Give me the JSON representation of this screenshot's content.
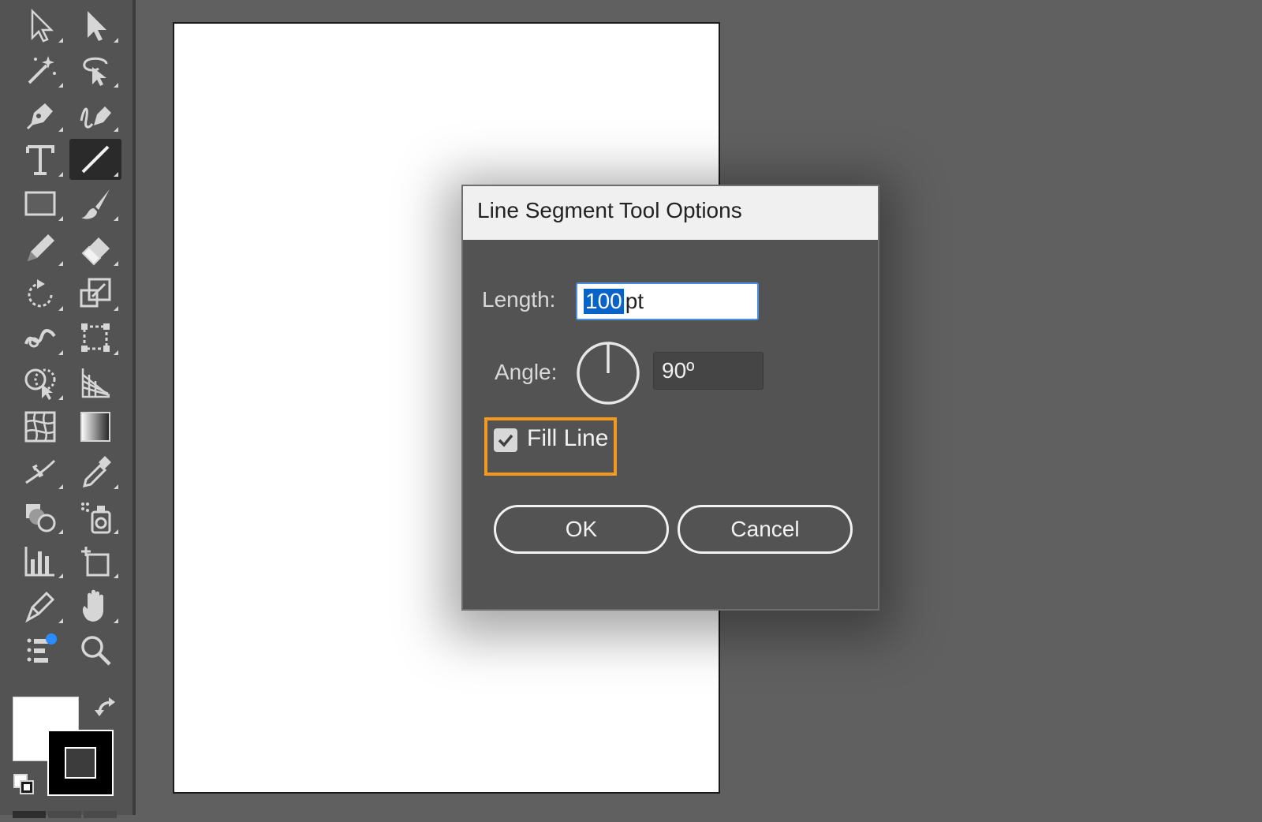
{
  "toolbar": {
    "tools": [
      {
        "name": "selection-tool",
        "icon": "selection-arrow-icon",
        "active": false
      },
      {
        "name": "direct-selection-tool",
        "icon": "direct-selection-arrow-icon",
        "active": false
      },
      {
        "name": "magic-wand-tool",
        "icon": "magic-wand-icon",
        "active": false
      },
      {
        "name": "lasso-tool",
        "icon": "lasso-icon",
        "active": false
      },
      {
        "name": "pen-tool",
        "icon": "pen-icon",
        "active": false
      },
      {
        "name": "curvature-tool",
        "icon": "curvature-pen-icon",
        "active": false
      },
      {
        "name": "type-tool",
        "icon": "type-icon",
        "active": false
      },
      {
        "name": "line-segment-tool",
        "icon": "line-segment-icon",
        "active": true
      },
      {
        "name": "rectangle-tool",
        "icon": "rectangle-icon",
        "active": false
      },
      {
        "name": "paintbrush-tool",
        "icon": "paintbrush-icon",
        "active": false
      },
      {
        "name": "pencil-tool",
        "icon": "pencil-icon",
        "active": false
      },
      {
        "name": "eraser-tool",
        "icon": "eraser-icon",
        "active": false
      },
      {
        "name": "rotate-tool",
        "icon": "rotate-icon",
        "active": false
      },
      {
        "name": "scale-tool",
        "icon": "scale-icon",
        "active": false
      },
      {
        "name": "warp-tool",
        "icon": "warp-icon",
        "active": false
      },
      {
        "name": "free-transform-tool",
        "icon": "free-transform-icon",
        "active": false
      },
      {
        "name": "shape-builder-tool",
        "icon": "shape-builder-icon",
        "active": false
      },
      {
        "name": "perspective-grid-tool",
        "icon": "perspective-grid-icon",
        "active": false
      },
      {
        "name": "mesh-tool",
        "icon": "mesh-icon",
        "active": false
      },
      {
        "name": "gradient-tool",
        "icon": "gradient-icon",
        "active": false
      },
      {
        "name": "width-tool",
        "icon": "width-icon",
        "active": false
      },
      {
        "name": "eyedropper-tool",
        "icon": "eyedropper-icon",
        "active": false
      },
      {
        "name": "blend-tool",
        "icon": "blend-icon",
        "active": false
      },
      {
        "name": "symbol-sprayer-tool",
        "icon": "symbol-sprayer-icon",
        "active": false
      },
      {
        "name": "column-graph-tool",
        "icon": "column-graph-icon",
        "active": false
      },
      {
        "name": "artboard-tool",
        "icon": "artboard-icon",
        "active": false
      },
      {
        "name": "slice-tool",
        "icon": "slice-icon",
        "active": false
      },
      {
        "name": "hand-tool",
        "icon": "hand-icon",
        "active": false
      },
      {
        "name": "edit-toolbar",
        "icon": "edit-toolbar-icon",
        "active": false
      },
      {
        "name": "zoom-tool",
        "icon": "zoom-icon",
        "active": false
      }
    ],
    "fill_color": "#ffffff",
    "stroke_color": "#000000"
  },
  "dialog": {
    "title": "Line Segment Tool Options",
    "length_label": "Length:",
    "length_value": "100",
    "length_unit": "pt",
    "angle_label": "Angle:",
    "angle_value": "90º",
    "fill_line_label": "Fill Line",
    "fill_line_checked": true,
    "ok_label": "OK",
    "cancel_label": "Cancel"
  },
  "colors": {
    "highlight": "#f39a1e",
    "selection": "#0a64c8"
  }
}
